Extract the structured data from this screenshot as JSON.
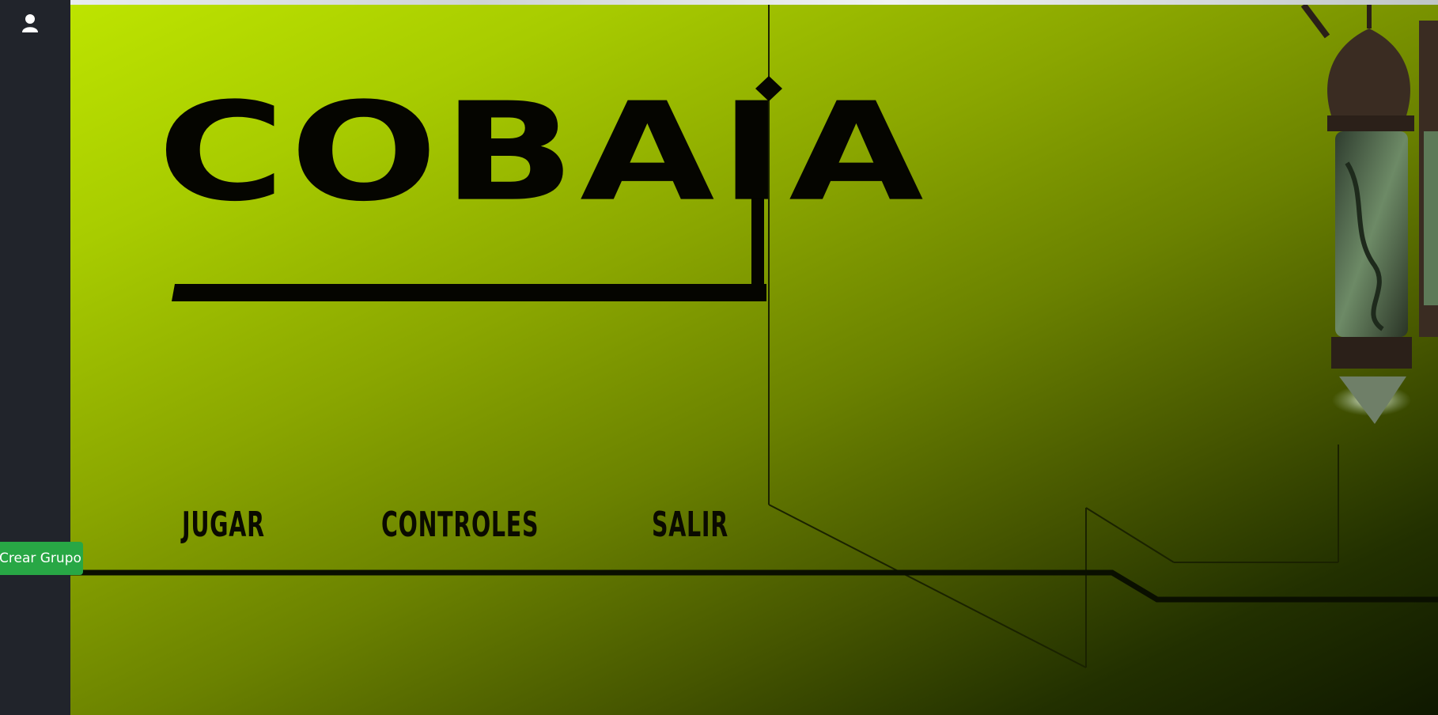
{
  "game": {
    "logo_text": "COBAIA"
  },
  "menu": {
    "play": "JUGAR",
    "controls": "CONTROLES",
    "exit": "SALIR"
  },
  "sidebar": {
    "user_icon": "user-icon",
    "create_group_label": "Crear Grupo"
  },
  "colors": {
    "sidebar_bg": "#21242b",
    "accent_green_button": "#28a745",
    "lime_start": "#bde400",
    "dark_end": "#0f1800"
  }
}
